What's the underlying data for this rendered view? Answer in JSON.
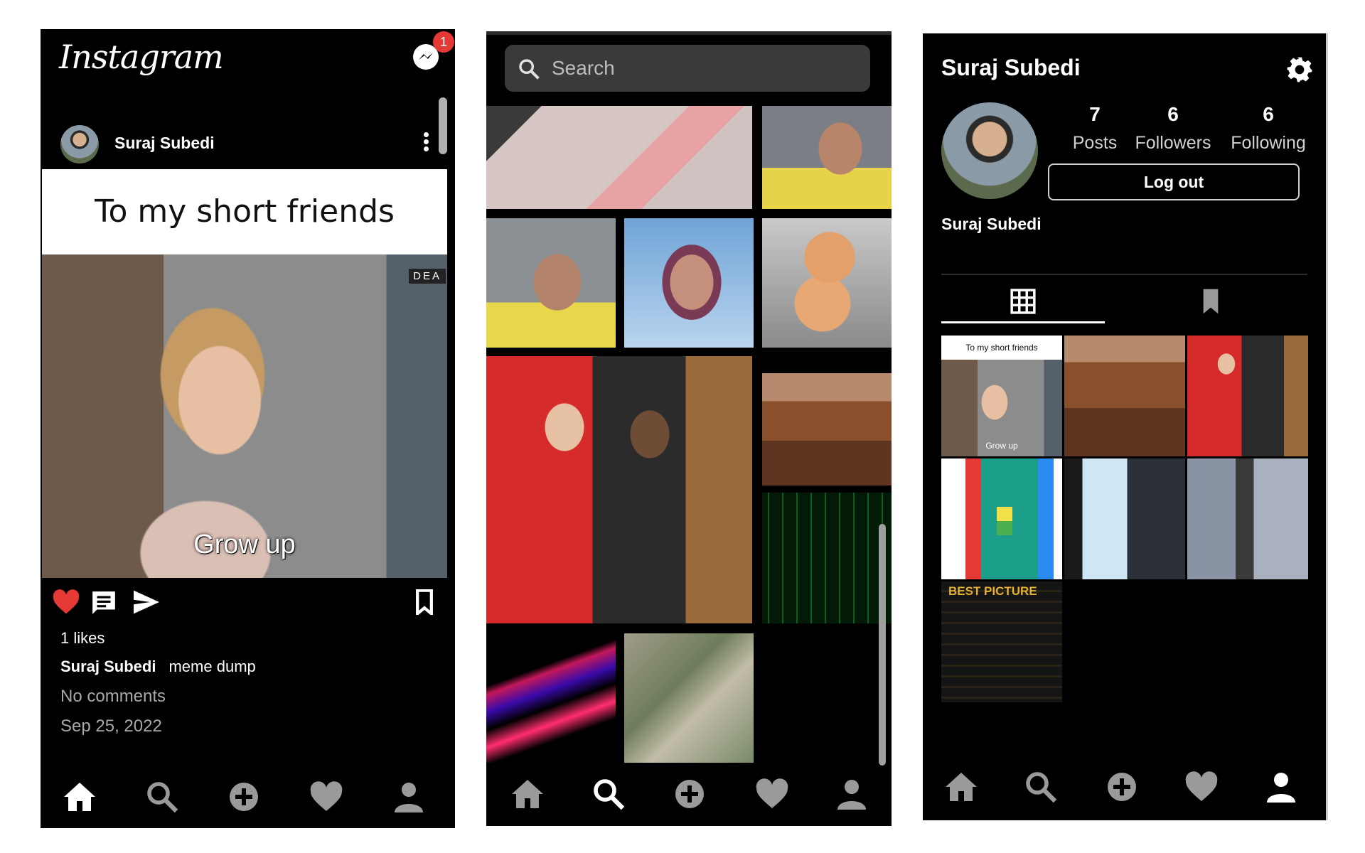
{
  "feed": {
    "brand": "Instagram",
    "notification_count": "1",
    "post": {
      "author": "Suraj Subedi",
      "caption_banner": "To my short friends",
      "watermark": "DEA",
      "image_caption": "Grow up",
      "likes": "1 likes",
      "caption_author": "Suraj Subedi",
      "caption_text": "meme dump",
      "comments": "No comments",
      "date": "Sep 25, 2022"
    }
  },
  "explore": {
    "search": {
      "placeholder": "Search"
    }
  },
  "profile": {
    "username": "Suraj Subedi",
    "display_name": "Suraj Subedi",
    "stats": [
      {
        "value": "7",
        "label": "Posts"
      },
      {
        "value": "6",
        "label": "Followers"
      },
      {
        "value": "6",
        "label": "Following"
      }
    ],
    "logout_label": "Log out",
    "thumb_post_caption": "To my short friends",
    "thumb_post_image_text": "Grow up",
    "thumb_best_picture": "BEST PICTURE"
  },
  "nav": {
    "items": [
      "home-icon",
      "search-icon",
      "add-icon",
      "heart-icon",
      "profile-icon"
    ]
  },
  "colors": {
    "background": "#000000",
    "like_red": "#e53935",
    "badge_red": "#e53935",
    "nav_inactive": "#9a9a9a",
    "nav_active": "#ffffff",
    "search_bg": "#3a3a3a"
  }
}
